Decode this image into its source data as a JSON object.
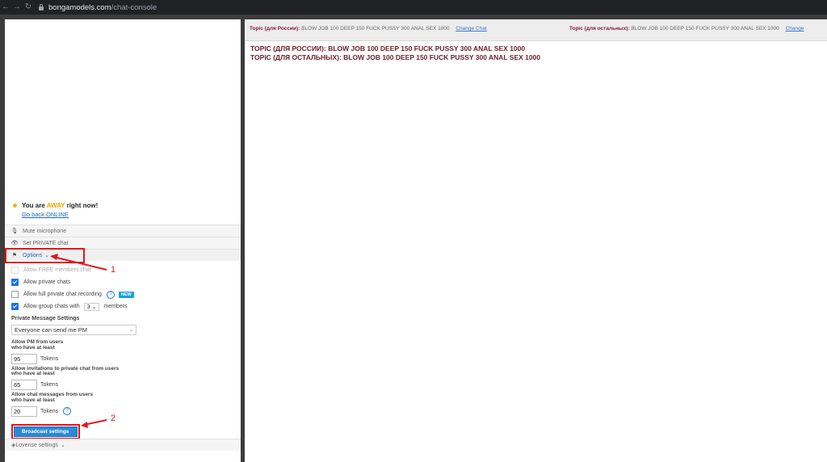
{
  "browser": {
    "url_host": "bongamodels.com",
    "url_path": "/chat-console"
  },
  "status": {
    "prefix": "You are ",
    "away_word": "AWAY",
    "suffix": " right now!",
    "link": "Go back ONLINE"
  },
  "rows": {
    "mute": "Mute microphone",
    "private": "Set PRIVATE chat",
    "options": "Options"
  },
  "options": {
    "allow_free": "Allow FREE members chat",
    "allow_private": "Allow private chats",
    "allow_recording": "Allow full private chat recording",
    "new_badge": "NEW",
    "group_prefix": "Allow group chats with",
    "group_count": "3",
    "group_suffix": "members",
    "pm_title": "Private Message Settings",
    "pm_select": "Everyone can send me PM",
    "pm_label_1": "Allow PM from users",
    "pm_label_2": "who have at least",
    "pm_value": "95",
    "inv_label_1": "Allow invitations to private chat from users",
    "inv_label_2": "who have at least",
    "inv_value": "65",
    "msg_label_1": "Allow chat messages from users",
    "msg_label_2": "who have at least",
    "msg_value": "20",
    "tokens": "Tokens",
    "button": "Broadcast settings"
  },
  "lovense": "Lovense settings",
  "topic_bar": {
    "ru_key": "Topic (для России):",
    "ru_val": "BLOW JOB 100 DEEP 150 FUCK PUSSY 300 ANAL SEX 1000",
    "change_ru": "Change Chat",
    "other_key": "Topic (для остальных):",
    "other_val": "BLOW JOB 100 DEEP 150 FUCK PUSSY 300 ANAL SEX 1000",
    "change_other": "Change"
  },
  "chat": {
    "line1": "TOPIC (ДЛЯ РОССИИ): BLOW JOB 100 DEEP 150 FUCK PUSSY 300 ANAL SEX 1000",
    "line2": "TOPIC (ДЛЯ ОСТАЛЬНЫХ): BLOW JOB 100 DEEP 150 FUCK PUSSY 300 ANAL SEX 1000"
  },
  "annotations": {
    "n1": "1",
    "n2": "2"
  }
}
